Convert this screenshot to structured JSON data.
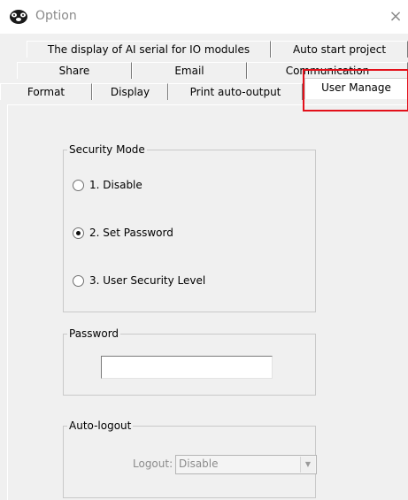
{
  "window": {
    "title": "Option",
    "close_symbol": "×",
    "app_icon": "app-logo-icon"
  },
  "tabs": {
    "row1": [
      "The display of AI serial for IO modules",
      "Auto start project"
    ],
    "row2": [
      "Share",
      "Email",
      "Communication"
    ],
    "row3": [
      "Format",
      "Display",
      "Print auto-output",
      "User Manage"
    ],
    "active": "User Manage",
    "highlight_color": "#e3101a"
  },
  "security_mode": {
    "title": "Security Mode",
    "options": [
      {
        "label": "1. Disable",
        "checked": false
      },
      {
        "label": "2. Set Password",
        "checked": true
      },
      {
        "label": "3. User Security Level",
        "checked": false
      }
    ]
  },
  "password": {
    "title": "Password",
    "value": ""
  },
  "auto_logout": {
    "title": "Auto-logout",
    "logout_label": "Logout:",
    "logout_value": "Disable",
    "arrow": "▼"
  }
}
